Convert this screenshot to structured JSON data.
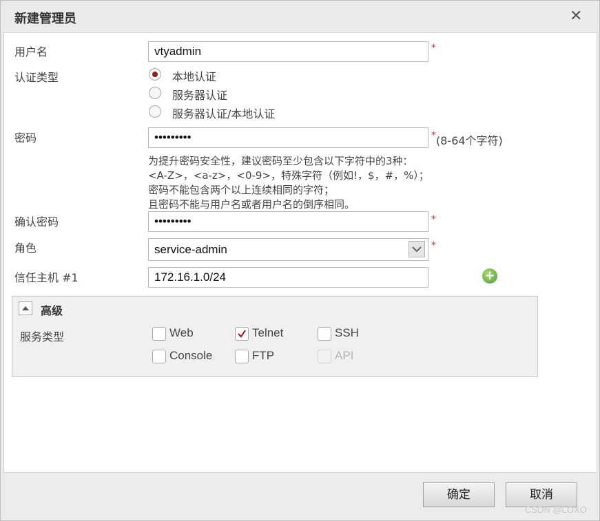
{
  "dialog": {
    "title": "新建管理员",
    "close_symbol": "✕"
  },
  "form": {
    "username": {
      "label": "用户名",
      "value": "vtyadmin",
      "required_mark": "*"
    },
    "auth_type": {
      "label": "认证类型",
      "options": [
        {
          "label": "本地认证",
          "selected": true
        },
        {
          "label": "服务器认证",
          "selected": false
        },
        {
          "label": "服务器认证/本地认证",
          "selected": false
        }
      ]
    },
    "password": {
      "label": "密码",
      "value": "•••••••••",
      "required_mark": "*",
      "suffix": "(8-64个字符)",
      "hint_lines": [
        "为提升密码安全性，建议密码至少包含以下字符中的3种：",
        "<A-Z>，<a-z>，<0-9>，特殊字符（例如!，$，#，%）；",
        "密码不能包含两个以上连续相同的字符；",
        "且密码不能与用户名或者用户名的倒序相同。"
      ]
    },
    "confirm_password": {
      "label": "确认密码",
      "value": "•••••••••",
      "required_mark": "*"
    },
    "role": {
      "label": "角色",
      "value": "service-admin",
      "required_mark": "*"
    },
    "trusted_host": {
      "label": "信任主机 #1",
      "value": "172.16.1.0/24",
      "add_icon": "plus-icon"
    }
  },
  "advanced": {
    "title": "高级",
    "service_type_label": "服务类型",
    "services": [
      {
        "label": "Web",
        "checked": false,
        "disabled": false
      },
      {
        "label": "Telnet",
        "checked": true,
        "disabled": false
      },
      {
        "label": "SSH",
        "checked": false,
        "disabled": false
      },
      {
        "label": "Console",
        "checked": false,
        "disabled": false
      },
      {
        "label": "FTP",
        "checked": false,
        "disabled": false
      },
      {
        "label": "API",
        "checked": false,
        "disabled": true
      }
    ]
  },
  "footer": {
    "ok_label": "确定",
    "cancel_label": "取消"
  },
  "watermark": "CSDN @LOXO",
  "colors": {
    "accent_radio": "#9c1c1c",
    "required": "#dd3333",
    "check": "#a52020",
    "add_icon": "#5aa832"
  }
}
